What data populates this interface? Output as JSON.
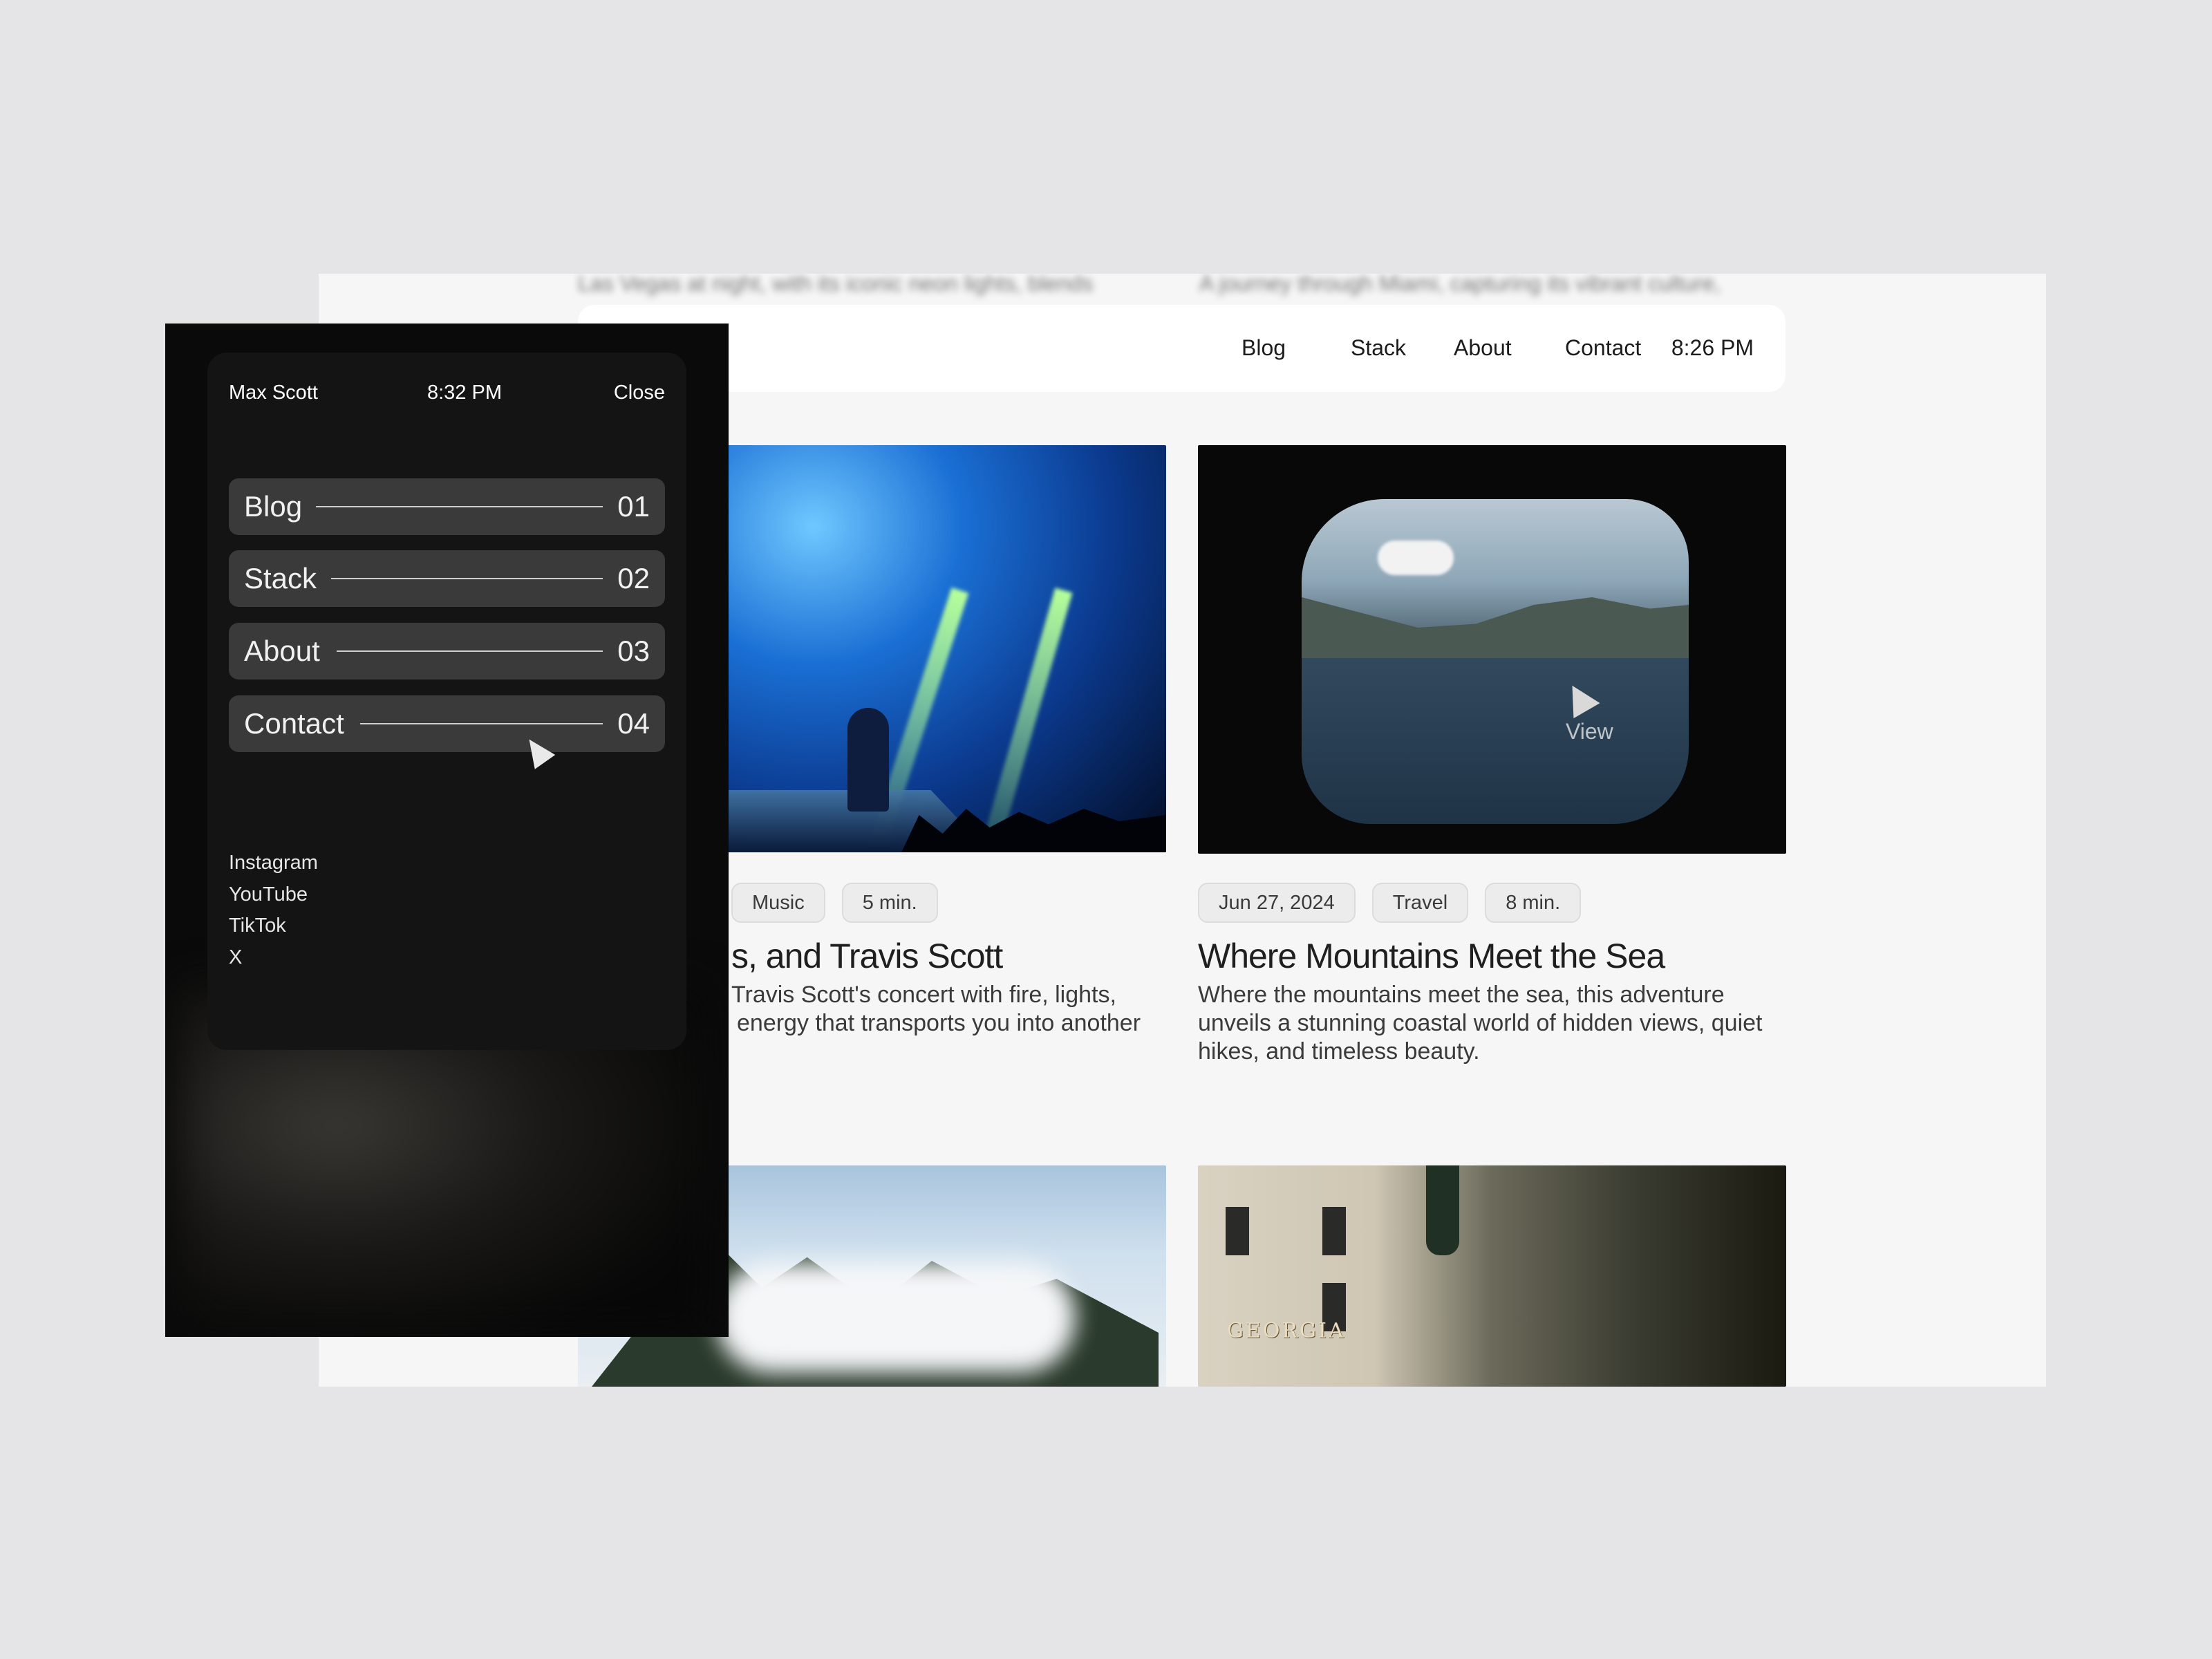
{
  "desktop": {
    "blurred_text_left": "Las Vegas at night, with its iconic neon lights, blends",
    "blurred_text_right": "A journey through Miami, capturing its vibrant culture,",
    "nav": {
      "links": [
        "Blog",
        "Stack",
        "About",
        "Contact"
      ],
      "time": "8:26 PM"
    },
    "cards": [
      {
        "tags": [
          "Music",
          "5 min."
        ],
        "title": "s, and Travis Scott",
        "desc_line1": "Travis Scott's concert with fire, lights,",
        "desc_line2": "energy that transports you into another"
      },
      {
        "tags": [
          "Jun 27, 2024",
          "Travel",
          "8 min."
        ],
        "title": "Where Mountains Meet the Sea",
        "description": "Where the mountains meet the sea, this adventure unveils a stunning coastal world of hidden views, quiet hikes, and timeless beauty.",
        "hover_label": "View"
      }
    ],
    "city_sign": "GEORGIA"
  },
  "mobile": {
    "name": "Max Scott",
    "time": "8:32 PM",
    "close": "Close",
    "menu": [
      {
        "label": "Blog",
        "num": "01"
      },
      {
        "label": "Stack",
        "num": "02"
      },
      {
        "label": "About",
        "num": "03"
      },
      {
        "label": "Contact",
        "num": "04"
      }
    ],
    "socials": [
      "Instagram",
      "YouTube",
      "TikTok",
      "X"
    ]
  }
}
